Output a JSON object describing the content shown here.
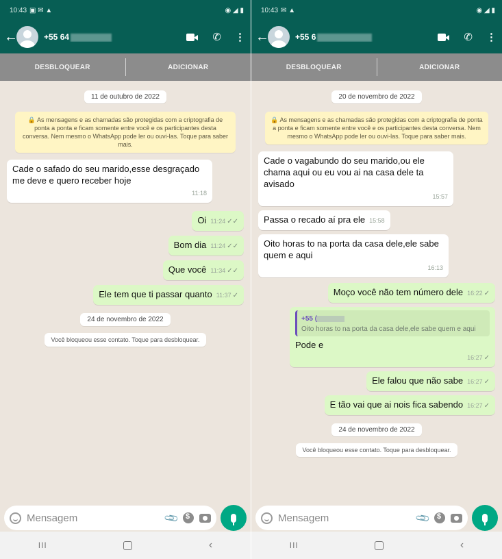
{
  "left": {
    "status": {
      "time": "10:43",
      "icons_left": "▣ ✉ ▲",
      "icons_right": "◉ ◢ ▮"
    },
    "header": {
      "contact": "+55 64"
    },
    "actions": {
      "unblock": "DESBLOQUEAR",
      "add": "ADICIONAR"
    },
    "date_first": "11 de outubro de 2022",
    "notice": "🔒 As mensagens e as chamadas são protegidas com a criptografia de ponta a ponta e ficam somente entre você e os participantes desta conversa. Nem mesmo o WhatsApp pode ler ou ouvi-las. Toque para saber mais.",
    "messages": [
      {
        "text": "Cade o safado do seu marido,esse desgraçado me deve e quero receber hoje",
        "time": "11:18"
      },
      {
        "text": "Oi",
        "time": "11:24"
      },
      {
        "text": "Bom dia",
        "time": "11:24"
      },
      {
        "text": "Que você",
        "time": "11:34"
      },
      {
        "text": "Ele tem que ti passar quanto",
        "time": "11:37"
      }
    ],
    "date_second": "24 de novembro de 2022",
    "system": "Você bloqueou esse contato. Toque para desbloquear.",
    "composer_placeholder": "Mensagem"
  },
  "right": {
    "status": {
      "time": "10:43",
      "icons_left": "✉ ▲",
      "icons_right": "◉ ◢ ▮"
    },
    "header": {
      "contact": "+55 6"
    },
    "actions": {
      "unblock": "DESBLOQUEAR",
      "add": "ADICIONAR"
    },
    "date_first": "20 de novembro de 2022",
    "notice": "🔒 As mensagens e as chamadas são protegidas com a criptografia de ponta a ponta e ficam somente entre você e os participantes desta conversa. Nem mesmo o WhatsApp pode ler ou ouvi-las. Toque para saber mais.",
    "messages": [
      {
        "text": "Cade o vagabundo do seu marido,ou ele chama aqui ou eu vou ai na casa dele ta avisado",
        "time": "15:57"
      },
      {
        "text": "Passa o recado aí pra ele",
        "time": "15:58"
      },
      {
        "text": "Oito horas to na porta da casa dele,ele sabe quem e aqui",
        "time": "16:13"
      },
      {
        "text": "Moço você não tem número dele",
        "time": "16:22"
      },
      {
        "text": "Pode e",
        "time": "16:27",
        "quote_name": "+55 (",
        "quote_text": "Oito horas to na porta da casa dele,ele sabe quem e aqui"
      },
      {
        "text": "Ele falou que não sabe",
        "time": "16:27"
      },
      {
        "text": "E tão vai que ai nois fica sabendo",
        "time": "16:27"
      }
    ],
    "date_second": "24 de novembro de 2022",
    "system": "Você bloqueou esse contato. Toque para desbloquear.",
    "composer_placeholder": "Mensagem"
  },
  "icons": {
    "back": "←",
    "call": "✆",
    "menu": "⋮",
    "clip": "📎",
    "nav_recent": "III",
    "nav_back": "‹",
    "tick_double": "✓✓",
    "tick_single": "✓"
  },
  "colors": {
    "header": "#075e54",
    "outgoing": "#dcf8c6",
    "incoming": "#ffffff",
    "chat_bg": "#ece5dd",
    "mic": "#00a884"
  }
}
